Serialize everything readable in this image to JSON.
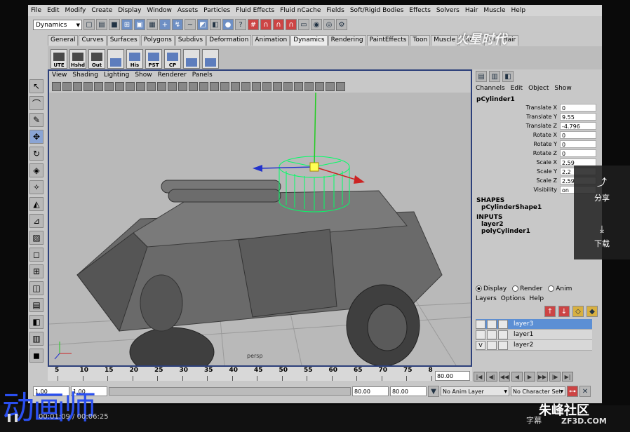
{
  "menubar": [
    "File",
    "Edit",
    "Modify",
    "Create",
    "Display",
    "Window",
    "Assets",
    "Particles",
    "Fluid Effects",
    "Fluid nCache",
    "Fields",
    "Soft/Rigid Bodies",
    "Effects",
    "Solvers",
    "Hair",
    "Muscle",
    "Help"
  ],
  "status_line": {
    "mode": "Dynamics"
  },
  "shelf_tabs": [
    "General",
    "Curves",
    "Surfaces",
    "Polygons",
    "Subdivs",
    "Deformation",
    "Animation",
    "Dynamics",
    "Rendering",
    "PaintEffects",
    "Toon",
    "Muscle",
    "Fluids",
    "Fur",
    "Hair"
  ],
  "shelf_buttons": [
    "UTE",
    "Hshd",
    "Out",
    "",
    "His",
    "PST",
    "CP",
    "",
    ""
  ],
  "watermark": "火星时代",
  "viewport": {
    "menu": [
      "View",
      "Shading",
      "Lighting",
      "Show",
      "Renderer",
      "Panels"
    ],
    "camera": "persp"
  },
  "channel_box": {
    "menu": [
      "Channels",
      "Edit",
      "Object",
      "Show"
    ],
    "object": "pCylinder1",
    "attributes": [
      {
        "name": "Translate X",
        "value": "0"
      },
      {
        "name": "Translate Y",
        "value": "9.55"
      },
      {
        "name": "Translate Z",
        "value": "-4.796"
      },
      {
        "name": "Rotate X",
        "value": "0"
      },
      {
        "name": "Rotate Y",
        "value": "0"
      },
      {
        "name": "Rotate Z",
        "value": "0"
      },
      {
        "name": "Scale X",
        "value": "2.59"
      },
      {
        "name": "Scale Y",
        "value": "2.2"
      },
      {
        "name": "Scale Z",
        "value": "2.59"
      },
      {
        "name": "Visibility",
        "value": "on"
      }
    ],
    "shapes_label": "SHAPES",
    "shape": "pCylinderShape1",
    "inputs_label": "INPUTS",
    "inputs": [
      "layer2",
      "polyCylinder1"
    ]
  },
  "layer_editor": {
    "modes": [
      "Display",
      "Render",
      "Anim"
    ],
    "menu": [
      "Layers",
      "Options",
      "Help"
    ],
    "layers": [
      {
        "name": "layer3",
        "v": "",
        "selected": true
      },
      {
        "name": "layer1",
        "v": "",
        "selected": false
      },
      {
        "name": "layer2",
        "v": "V",
        "selected": false
      }
    ]
  },
  "timeline": {
    "ticks": [
      "5",
      "10",
      "15",
      "20",
      "25",
      "30",
      "35",
      "40",
      "45",
      "50",
      "55",
      "60",
      "65",
      "70",
      "75",
      "8"
    ],
    "current_frame": "80.00"
  },
  "range": {
    "start": "1.00",
    "playback_start": "1.00",
    "playback_end": "80.00",
    "end": "80.00",
    "anim_layer": "No Anim Layer",
    "char_set": "No Character Set"
  },
  "side_panel": {
    "share": "分享",
    "download": "下载"
  },
  "video": {
    "title": "动画师",
    "timecode": "00:01:09 / 00:06:25",
    "subtitle": "字幕",
    "brand": "朱峰社区",
    "brand_url": "ZF3D.COM"
  }
}
